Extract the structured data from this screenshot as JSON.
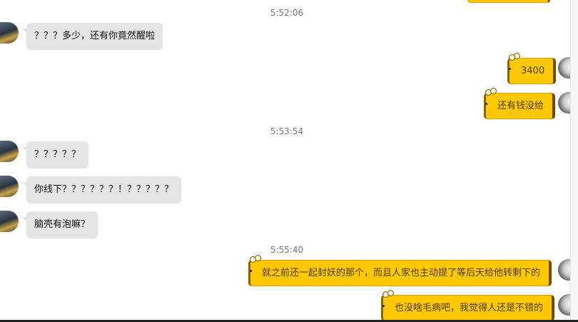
{
  "timestamps": [
    "5:52:06",
    "5:53:54",
    "5:55:40"
  ],
  "messages": {
    "m1": "？？？多少，还有你竟然醒啦",
    "m2": "3400",
    "m3": "还有钱没给",
    "m4": "？？？？？",
    "m5": "你线下？？？？？？！？？？？？",
    "m6": "脑壳有泡嘛？",
    "m7": "就之前还一起封妖的那个，而且人家也主动提了等后天给他转剩下的",
    "m8": "也没啥毛病吧，我觉得人还是不错的"
  },
  "colors": {
    "incoming_bubble": "#e4e4e4",
    "outgoing_bubble": "#ffc800",
    "outgoing_border": "#6b4b00",
    "timestamp_text": "#777777"
  }
}
